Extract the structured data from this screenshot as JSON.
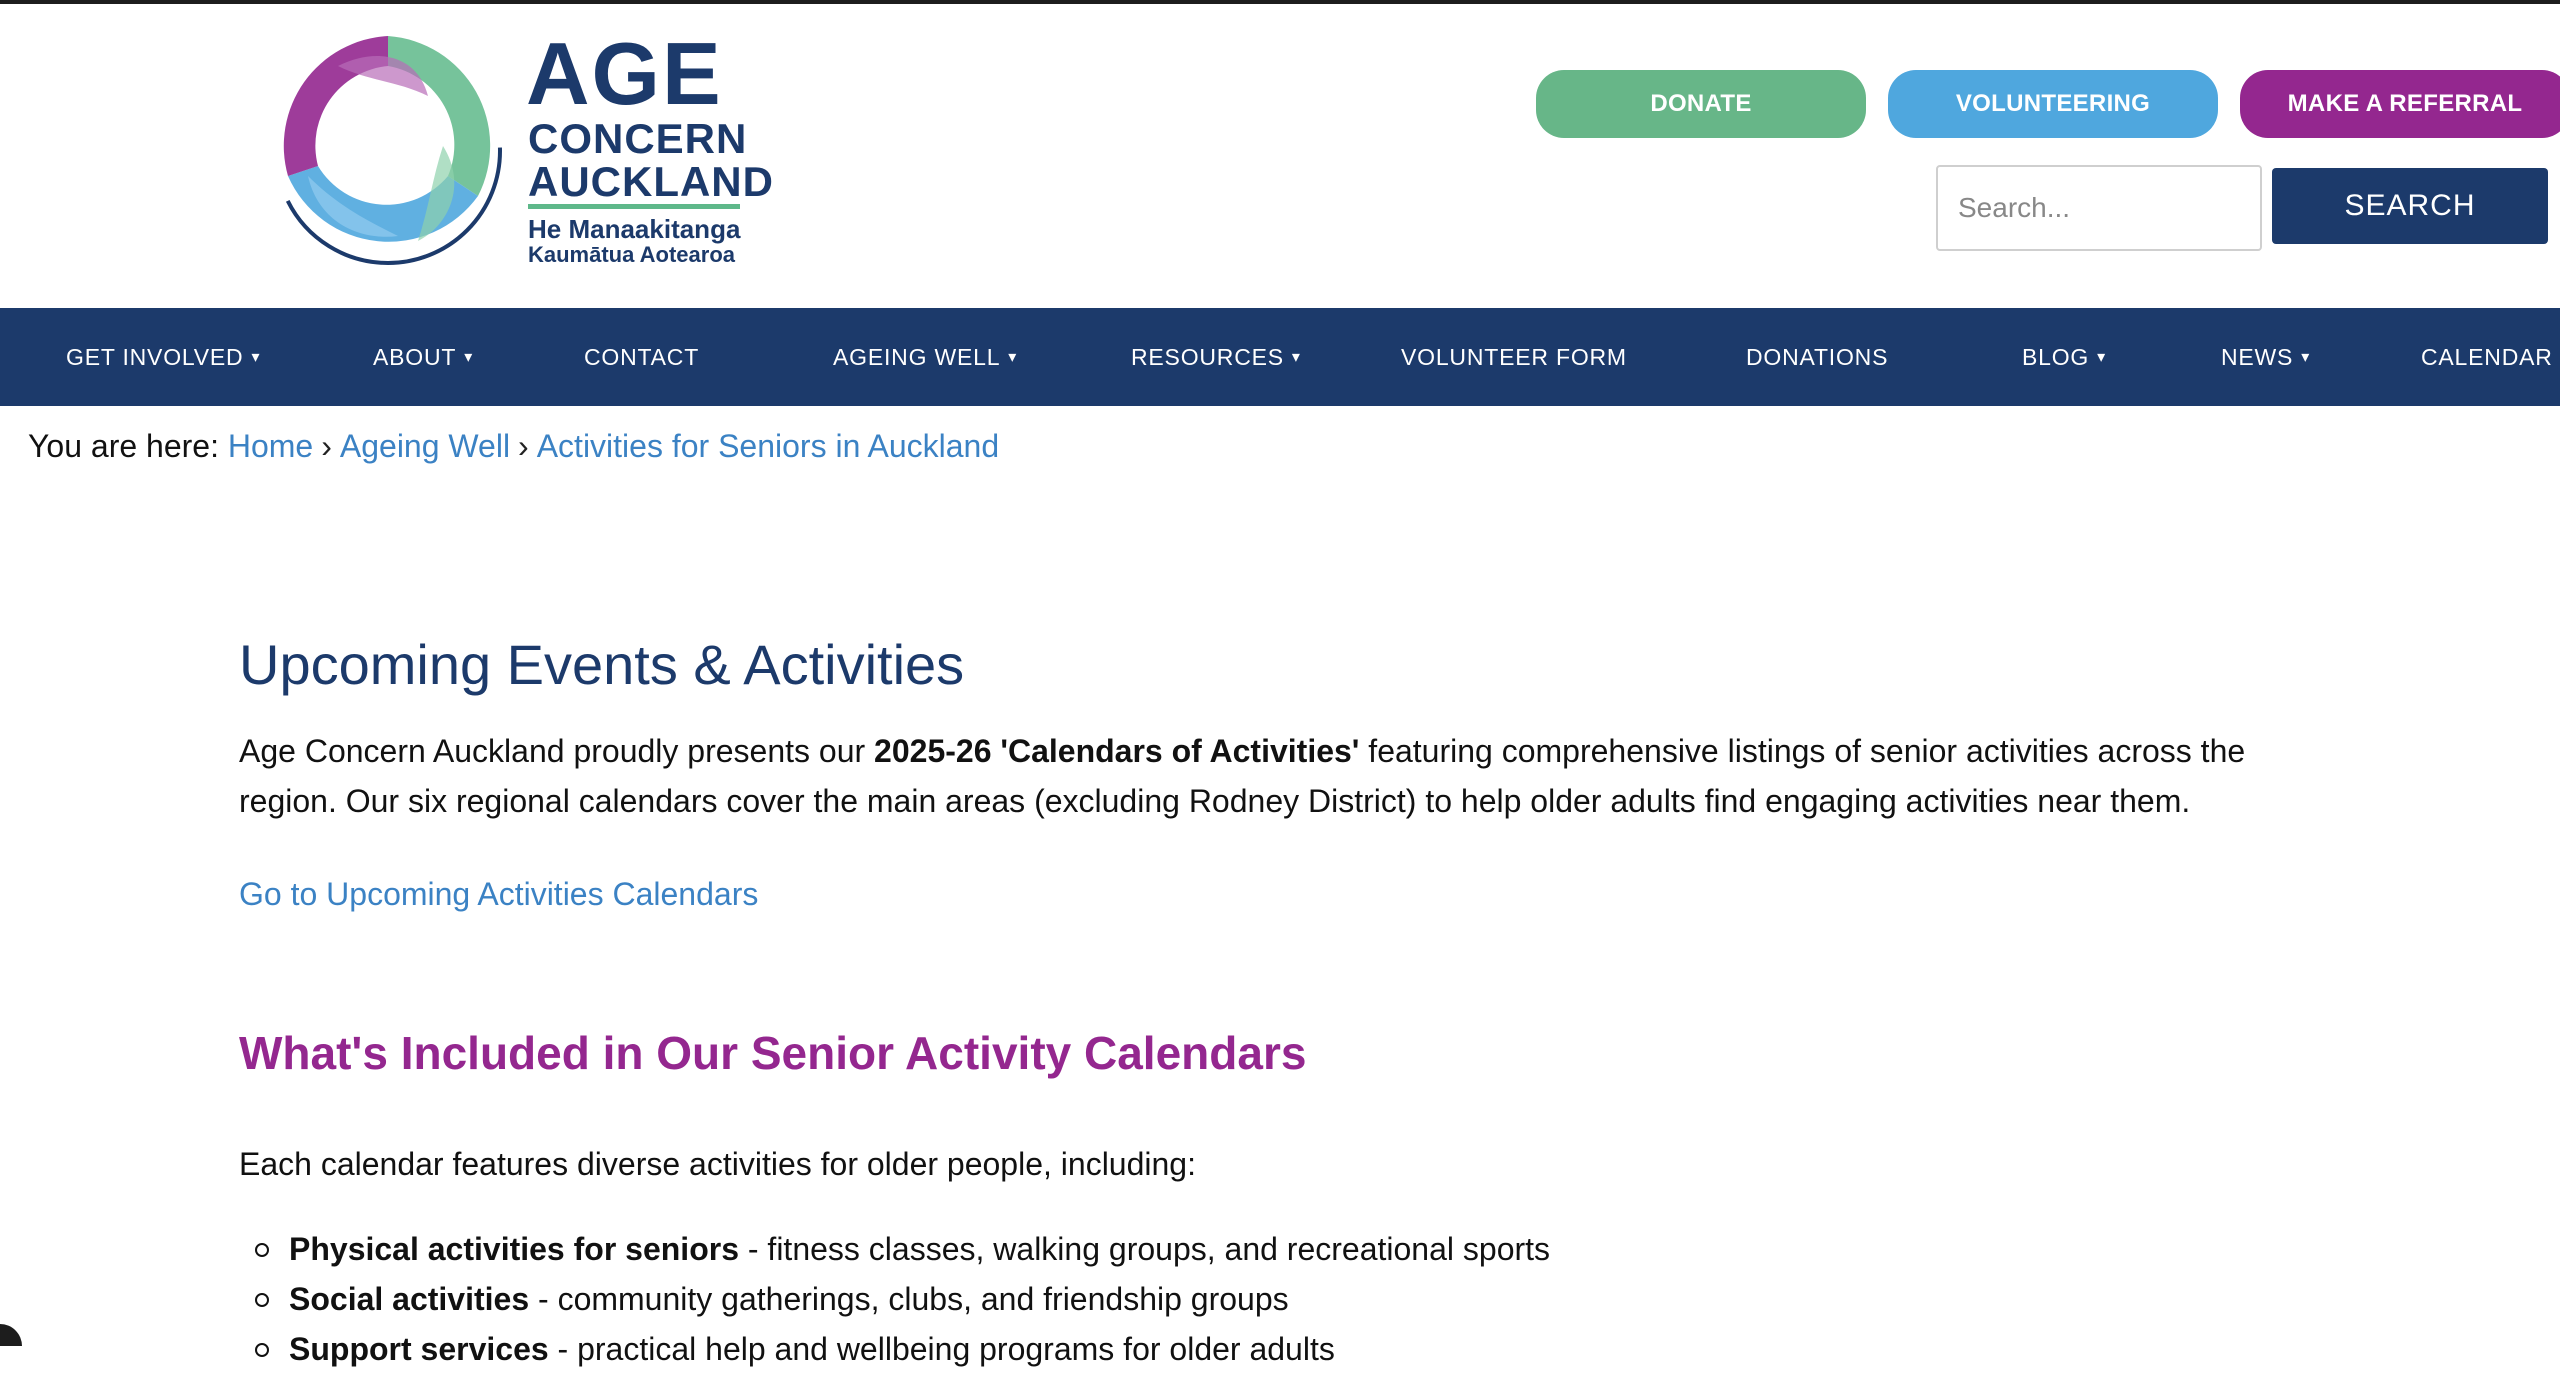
{
  "logo": {
    "word1": "AGE",
    "word2": "CONCERN",
    "word3": "AUCKLAND",
    "tagline1": "He Manaakitanga",
    "tagline2": "Kaumātua Aotearoa"
  },
  "header": {
    "donate_label": "DONATE",
    "volunteering_label": "VOLUNTEERING",
    "referral_label": "MAKE A REFERRAL",
    "search_placeholder": "Search...",
    "search_button": "SEARCH"
  },
  "nav": {
    "items": [
      {
        "label": "GET INVOLVED",
        "dropdown": "▾"
      },
      {
        "label": "ABOUT",
        "dropdown": "▾"
      },
      {
        "label": "CONTACT"
      },
      {
        "label": "AGEING WELL",
        "dropdown": "▾"
      },
      {
        "label": "RESOURCES",
        "dropdown": "▾"
      },
      {
        "label": "VOLUNTEER FORM"
      },
      {
        "label": "DONATIONS"
      },
      {
        "label": "BLOG",
        "dropdown": "▾"
      },
      {
        "label": "NEWS",
        "dropdown": "▾"
      },
      {
        "label": "CALENDAR"
      }
    ]
  },
  "breadcrumb": {
    "prefix": "You are here:",
    "items": [
      "Home",
      "Ageing Well",
      "Activities for Seniors in Auckland"
    ],
    "separator": "›"
  },
  "main": {
    "title": "Upcoming Events & Activities",
    "intro_before": "Age Concern Auckland proudly presents our ",
    "intro_bold": "2025-26 'Calendars of Activities'",
    "intro_after": " featuring comprehensive listings of senior activities across the region. Our six regional calendars cover the main areas (excluding Rodney District) to help older adults find engaging activities near them.",
    "calendars_link": "Go to Upcoming Activities Calendars",
    "section_title": "What's Included in Our Senior Activity Calendars",
    "section_lead": "Each calendar features diverse activities for older people, including:",
    "list": [
      {
        "bold": "Physical activities for seniors",
        "text": " - fitness classes, walking groups, and recreational sports"
      },
      {
        "bold": "Social activities",
        "text": " - community gatherings, clubs, and friendship groups"
      },
      {
        "bold": "Support services",
        "text": " - practical help and wellbeing programs for older adults"
      }
    ]
  },
  "colors": {
    "navy": "#1c3a6b",
    "green": "#67b688",
    "blue": "#4fa7de",
    "purple": "#94278f",
    "link": "#3b82c4"
  }
}
